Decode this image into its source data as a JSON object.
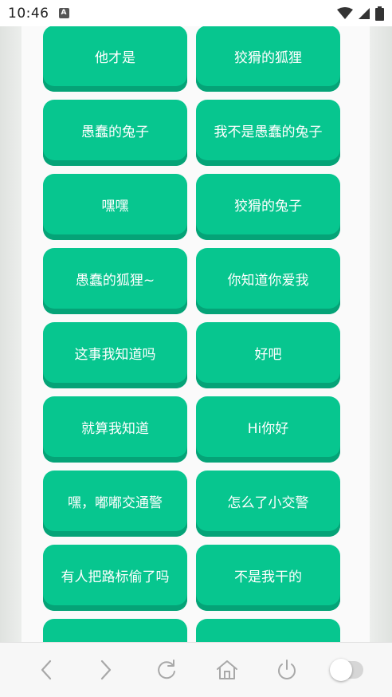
{
  "status_bar": {
    "time": "10:46",
    "notification_icon": "A",
    "icons": [
      "wifi-icon",
      "signal-icon",
      "battery-icon"
    ]
  },
  "buttons": [
    "他才是",
    "狡猾的狐狸",
    "愚蠢的兔子",
    "我不是愚蠢的兔子",
    "嘿嘿",
    "狡猾的兔子",
    "愚蠢的狐狸~",
    "你知道你爱我",
    "这事我知道吗",
    "好吧",
    "就算我知道",
    "Hi你好",
    "嘿，嘟嘟交通警",
    "怎么了小交警",
    "有人把路标偷了吗",
    "不是我干的",
    "",
    ""
  ],
  "nav": {
    "items": [
      "back-icon",
      "forward-icon",
      "refresh-icon",
      "home-icon",
      "power-icon",
      "toggle-switch"
    ]
  },
  "colors": {
    "button": "#07c68f",
    "button_shadow": "#05a377",
    "panel": "#fafafa"
  }
}
